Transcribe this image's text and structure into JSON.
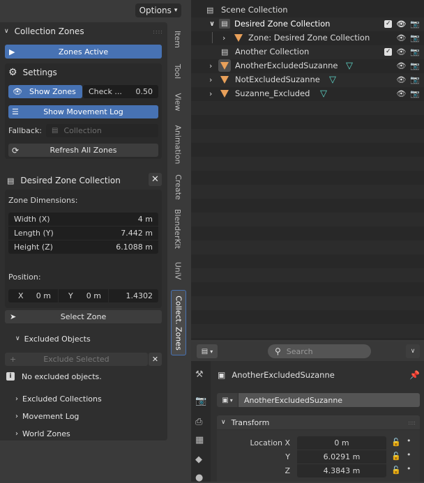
{
  "viewport": {
    "options_label": "Options"
  },
  "npanel": {
    "title": "Collection Zones",
    "zones_active_label": "Zones Active",
    "settings": {
      "title": "Settings",
      "show_zones_label": "Show Zones",
      "check_label": "Check ...",
      "check_value": "0.50",
      "show_movement_log_label": "Show Movement Log",
      "fallback_label": "Fallback:",
      "fallback_placeholder": "Collection",
      "refresh_label": "Refresh All Zones"
    },
    "zone": {
      "title": "Desired Zone Collection",
      "dimensions_label": "Zone Dimensions:",
      "width_label": "Width (X)",
      "width_value": "4 m",
      "length_label": "Length (Y)",
      "length_value": "7.442 m",
      "height_label": "Height (Z)",
      "height_value": "6.1088 m",
      "position_label": "Position:",
      "pos_x_label": "X",
      "pos_x_value": "0 m",
      "pos_y_label": "Y",
      "pos_y_value": "0 m",
      "pos_z_value": "1.4302",
      "select_zone_label": "Select Zone"
    },
    "excluded": {
      "title": "Excluded Objects",
      "exclude_selected_label": "Exclude Selected",
      "empty_message": "No excluded objects."
    },
    "sections": [
      "Excluded Collections",
      "Movement Log",
      "World Zones"
    ]
  },
  "tabs": [
    "Item",
    "Tool",
    "View",
    "Animation",
    "Create",
    "BlenderKit",
    "UniV",
    "Collect. Zones"
  ],
  "outliner": {
    "rows": [
      {
        "label": "Scene Collection"
      },
      {
        "label": "Desired Zone Collection"
      },
      {
        "label": "Zone: Desired Zone Collection"
      },
      {
        "label": "Another Collection"
      },
      {
        "label": "AnotherExcludedSuzanne"
      },
      {
        "label": "NotExcludedSuzanne"
      },
      {
        "label": "Suzanne_Excluded"
      }
    ]
  },
  "properties": {
    "search_placeholder": "Search",
    "object_name": "AnotherExcludedSuzanne",
    "object_field_value": "AnotherExcludedSuzanne",
    "transform_label": "Transform",
    "location_x_label": "Location X",
    "location_x_value": "0 m",
    "location_y_label": "Y",
    "location_y_value": "6.0291 m",
    "location_z_label": "Z",
    "location_z_value": "4.3843 m"
  },
  "colors": {
    "accent_blue": "#4772b3",
    "selection": "#334766",
    "object_orange": "#e8a05a",
    "mesh_teal": "#5fd6c8"
  }
}
